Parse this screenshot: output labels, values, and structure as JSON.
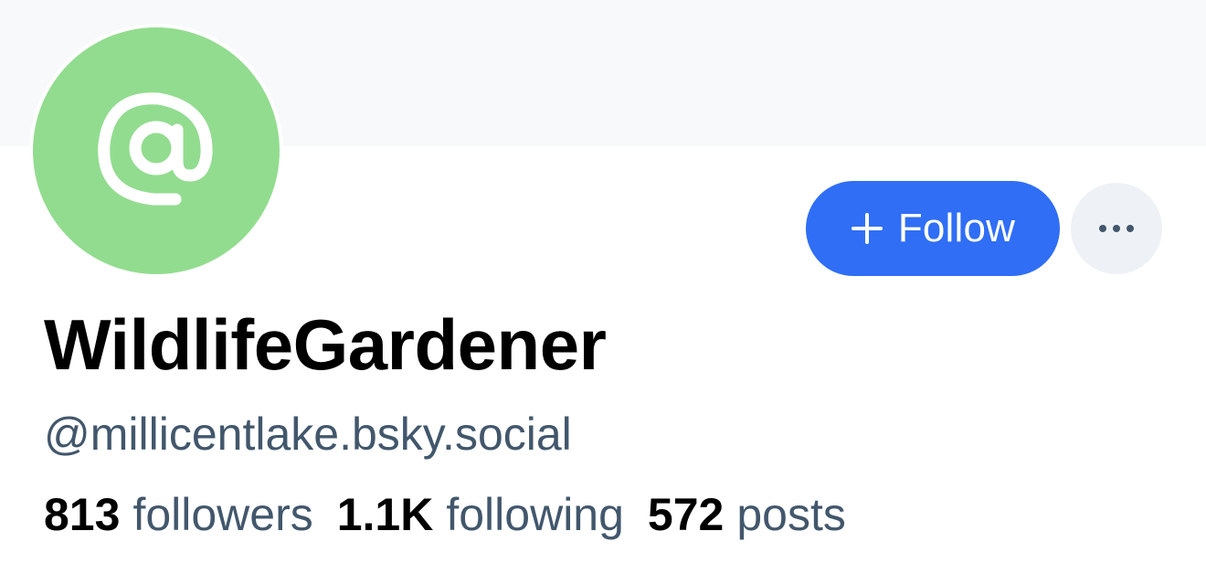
{
  "profile": {
    "display_name": "WildlifeGardener",
    "handle": "@millicentlake.bsky.social",
    "avatar": {
      "icon": "at-sign-icon",
      "color": "#92dc8f"
    }
  },
  "actions": {
    "follow_label": "Follow",
    "follow_icon": "plus-icon",
    "more_icon": "ellipsis-icon"
  },
  "stats": [
    {
      "count": "813",
      "label": "followers"
    },
    {
      "count": "1.1K",
      "label": "following"
    },
    {
      "count": "572",
      "label": "posts"
    }
  ],
  "colors": {
    "banner": "#f7f9fb",
    "accent": "#2f6ef5",
    "more_button_bg": "#eef1f5",
    "secondary_text": "#42576c"
  }
}
